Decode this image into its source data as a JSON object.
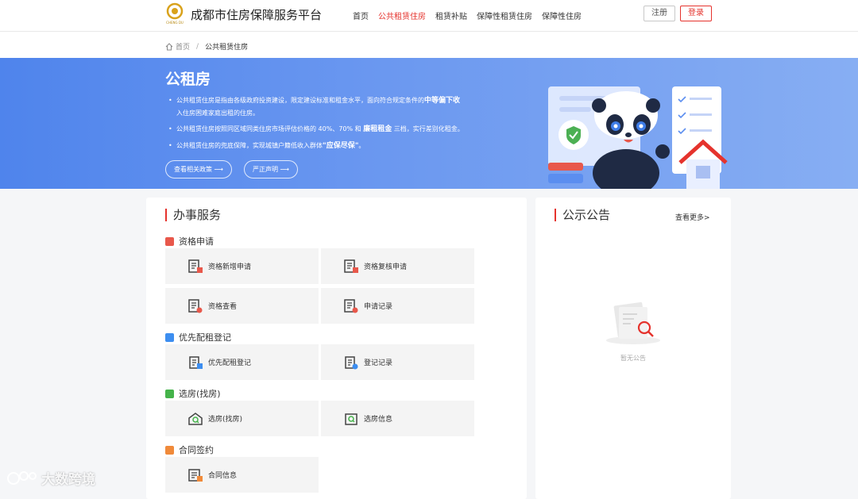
{
  "header": {
    "logo_text": "CHENG DU",
    "site_title": "成都市住房保障服务平台",
    "nav": [
      {
        "label": "首页",
        "active": false
      },
      {
        "label": "公共租赁住房",
        "active": true
      },
      {
        "label": "租赁补贴",
        "active": false
      },
      {
        "label": "保障性租赁住房",
        "active": false
      },
      {
        "label": "保障性住房",
        "active": false
      }
    ],
    "register_label": "注册",
    "login_label": "登录"
  },
  "breadcrumb": {
    "home": "首页",
    "separator": "/",
    "current": "公共租赁住房"
  },
  "banner": {
    "title": "公租房",
    "bullets": [
      {
        "pre": "公共租赁住房是指由各级政府投资建设，限定建设标准和租金水平，面向符合规定条件的",
        "bold": "中等偏下收",
        "post": "入住房困难家庭出租的住房。"
      },
      {
        "pre": "公共租赁住房按照同区域同类住房市场评估价格的 40%、70% 和",
        "bold": "廉租租金",
        "post": "三档，实行差别化租金。"
      },
      {
        "pre": "公共租赁住房的兜底保障，实现城镇户籍低收入群体",
        "bold": "\"应保尽保\"",
        "post": "。"
      }
    ],
    "btn_policy": "查看相关政策 ⟶",
    "btn_statement": "严正声明 ⟶"
  },
  "services": {
    "title": "办事服务",
    "sections": [
      {
        "title": "资格申请",
        "color": "#e8584b",
        "items": [
          "资格新增申请",
          "资格复核申请",
          "资格查看",
          "申请记录"
        ]
      },
      {
        "title": "优先配租登记",
        "color": "#3d8ef0",
        "items": [
          "优先配租登记",
          "登记记录"
        ]
      },
      {
        "title": "选房(找房)",
        "color": "#45b34a",
        "items": [
          "选房(找房)",
          "选房信息"
        ]
      },
      {
        "title": "合同签约",
        "color": "#f08a3a",
        "items": [
          "合同信息"
        ]
      }
    ]
  },
  "notice": {
    "title": "公示公告",
    "more": "查看更多>",
    "empty": "暂无公告"
  },
  "watermark": "大数跨境",
  "colors": {
    "accent": "#e5332d",
    "banner_start": "#4f84ec",
    "banner_end": "#87aef3"
  }
}
